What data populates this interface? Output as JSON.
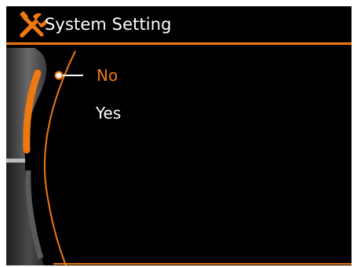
{
  "header": {
    "title": "System Setting",
    "icon": "tools-icon"
  },
  "options": [
    {
      "label": "No",
      "selected": true
    },
    {
      "label": "Yes",
      "selected": false
    }
  ],
  "colors": {
    "accent": "#f07812",
    "background": "#000000",
    "text": "#ffffff"
  }
}
